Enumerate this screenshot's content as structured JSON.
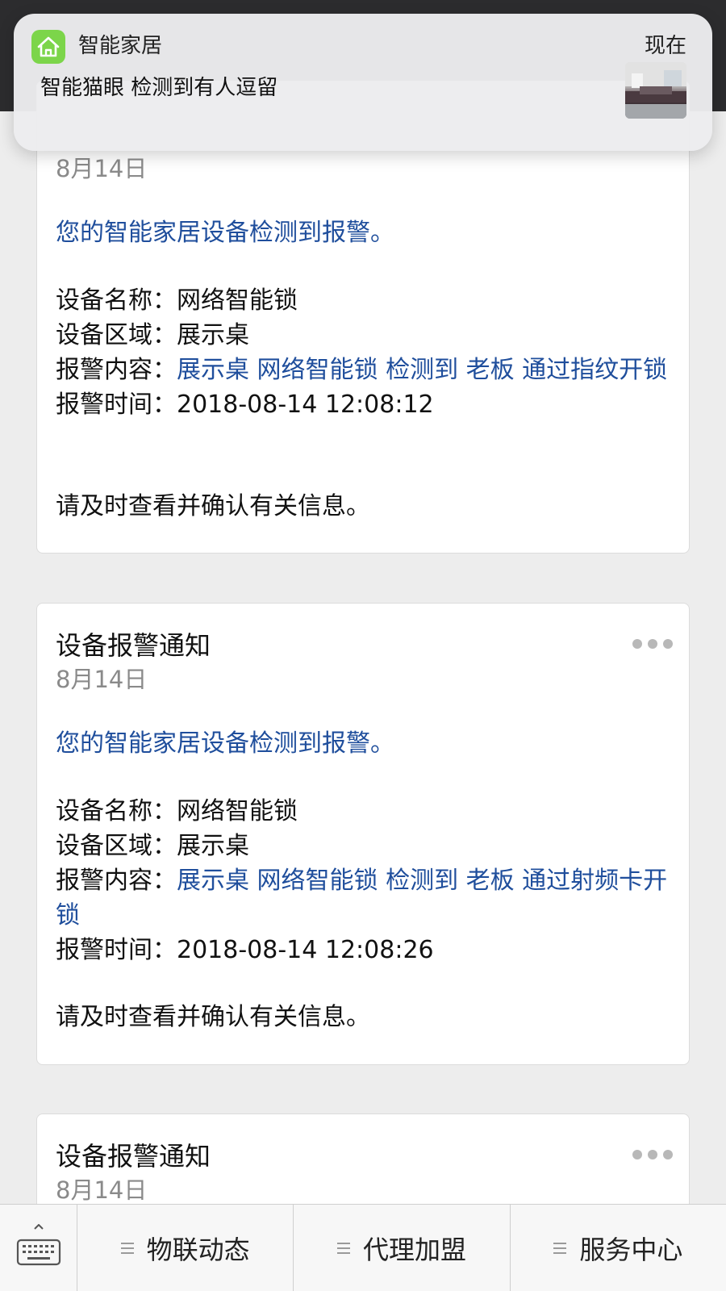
{
  "notification": {
    "app_name": "智能家居",
    "time": "现在",
    "message": "智能猫眼 检测到有人逗留",
    "app_icon": "home-icon",
    "app_icon_color": "#7cd54a"
  },
  "cards": [
    {
      "title": "",
      "date": "8月14日",
      "intro": "您的智能家居设备检测到报警。",
      "device_name_label": "设备名称：",
      "device_name": "网络智能锁",
      "area_label": "设备区域：",
      "area": "展示桌",
      "content_label": "报警内容：",
      "content": "展示桌 网络智能锁 检测到 老板 通过指纹开锁",
      "time_label": "报警时间：",
      "time": "2018-08-14 12:08:12",
      "footer": "请及时查看并确认有关信息。"
    },
    {
      "title": "设备报警通知",
      "date": "8月14日",
      "intro": "您的智能家居设备检测到报警。",
      "device_name_label": "设备名称：",
      "device_name": "网络智能锁",
      "area_label": "设备区域：",
      "area": "展示桌",
      "content_label": "报警内容：",
      "content": "展示桌 网络智能锁 检测到 老板 通过射频卡开锁",
      "time_label": "报警时间：",
      "time": "2018-08-14 12:08:26",
      "footer": "请及时查看并确认有关信息。"
    },
    {
      "title": "设备报警通知",
      "date": "8月14日"
    }
  ],
  "bottom_menu": {
    "keyboard_icon": "keyboard-icon",
    "items": [
      "物联动态",
      "代理加盟",
      "服务中心"
    ]
  },
  "colors": {
    "link_blue": "#1f4e9c",
    "muted_gray": "#8a8a8a",
    "background": "#ededed"
  }
}
